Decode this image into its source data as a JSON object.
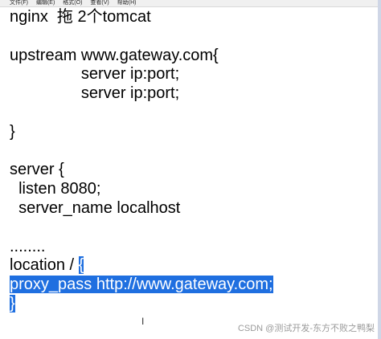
{
  "menu": {
    "items": [
      "文件(F)",
      "编辑(E)",
      "格式(O)",
      "查看(V)",
      "帮助(H)"
    ]
  },
  "editor": {
    "lines": [
      "nginx  拖 2个tomcat",
      "",
      "upstream www.gateway.com{",
      "                server ip:port;",
      "                server ip:port;",
      "",
      "}",
      "",
      "server {",
      "  listen 8080;",
      "  server_name localhost",
      "",
      "........",
      "location / ",
      "",
      "",
      ""
    ],
    "location_brace": "{",
    "proxy_line": "proxy_pass http://www.gateway.com;",
    "closing_brace": "}"
  },
  "watermark": "CSDN @测试开发-东方不败之鸭梨",
  "colors": {
    "selection": "#1f6fe0",
    "text": "#000000",
    "background": "#ffffff"
  }
}
